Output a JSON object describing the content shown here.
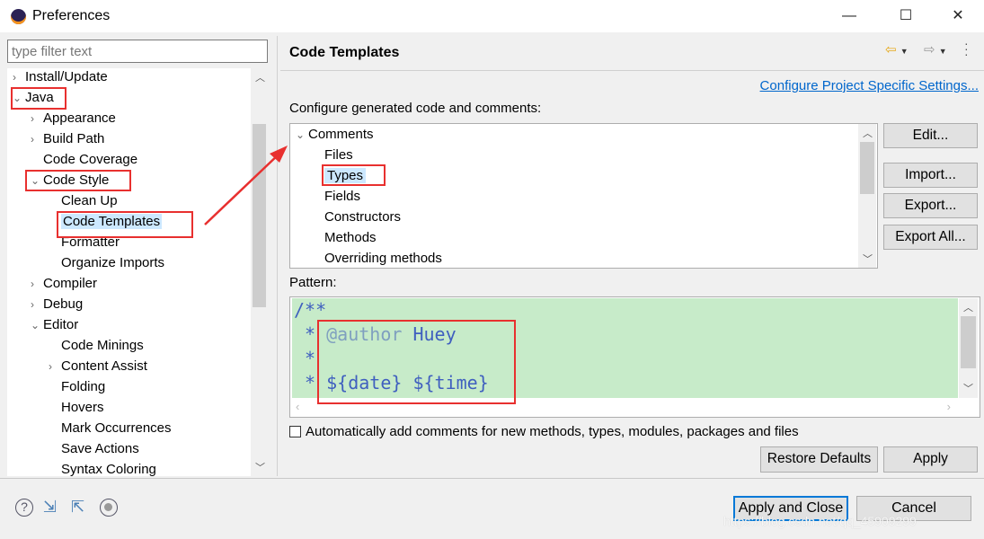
{
  "window": {
    "title": "Preferences",
    "minimize": "—",
    "maximize": "☐",
    "close": "✕"
  },
  "filter": {
    "placeholder": "type filter text"
  },
  "tree": [
    {
      "label": "Install/Update",
      "level": 0,
      "chev": "›"
    },
    {
      "label": "Java",
      "level": 0,
      "chev": "⌄"
    },
    {
      "label": "Appearance",
      "level": 1,
      "chev": "›"
    },
    {
      "label": "Build Path",
      "level": 1,
      "chev": "›"
    },
    {
      "label": "Code Coverage",
      "level": 1,
      "chev": ""
    },
    {
      "label": "Code Style",
      "level": 1,
      "chev": "⌄"
    },
    {
      "label": "Clean Up",
      "level": 2,
      "chev": ""
    },
    {
      "label": "Code Templates",
      "level": 2,
      "chev": "",
      "selected": true
    },
    {
      "label": "Formatter",
      "level": 2,
      "chev": ""
    },
    {
      "label": "Organize Imports",
      "level": 2,
      "chev": ""
    },
    {
      "label": "Compiler",
      "level": 1,
      "chev": "›"
    },
    {
      "label": "Debug",
      "level": 1,
      "chev": "›"
    },
    {
      "label": "Editor",
      "level": 1,
      "chev": "⌄"
    },
    {
      "label": "Code Minings",
      "level": 2,
      "chev": ""
    },
    {
      "label": "Content Assist",
      "level": 2,
      "chev": "›"
    },
    {
      "label": "Folding",
      "level": 2,
      "chev": ""
    },
    {
      "label": "Hovers",
      "level": 2,
      "chev": ""
    },
    {
      "label": "Mark Occurrences",
      "level": 2,
      "chev": ""
    },
    {
      "label": "Save Actions",
      "level": 2,
      "chev": ""
    },
    {
      "label": "Syntax Coloring",
      "level": 2,
      "chev": ""
    }
  ],
  "page": {
    "title": "Code Templates",
    "link": "Configure Project Specific Settings...",
    "description": "Configure generated code and comments:",
    "templates": [
      {
        "label": "Comments",
        "level": 0,
        "chev": "⌄"
      },
      {
        "label": "Files",
        "level": 1
      },
      {
        "label": "Types",
        "level": 1,
        "selected": true
      },
      {
        "label": "Fields",
        "level": 1
      },
      {
        "label": "Constructors",
        "level": 1
      },
      {
        "label": "Methods",
        "level": 1
      },
      {
        "label": "Overriding methods",
        "level": 1
      }
    ],
    "buttons": {
      "edit": "Edit...",
      "import": "Import...",
      "export": "Export...",
      "export_all": "Export All..."
    },
    "pattern_label": "Pattern:",
    "pattern": {
      "l1": "/**",
      "l2a": " * ",
      "l2b": "@author",
      "l2c": " Huey",
      "l3": " *",
      "l4a": " * ",
      "l4b": "${date} ${time}"
    },
    "auto_comments": {
      "label": "Automatically add comments for new methods, types, modules, packages and files",
      "checked": false
    },
    "restore": "Restore Defaults",
    "apply": "Apply"
  },
  "footer": {
    "apply_close": "Apply and Close",
    "cancel": "Cancel",
    "watermark": "https://blog.csdn.net/qq_45909299"
  },
  "colors": {
    "highlight": "#e8302f",
    "pattern_bg": "#c7ebc9",
    "link": "#0066cc",
    "selection": "#cce8ff"
  }
}
